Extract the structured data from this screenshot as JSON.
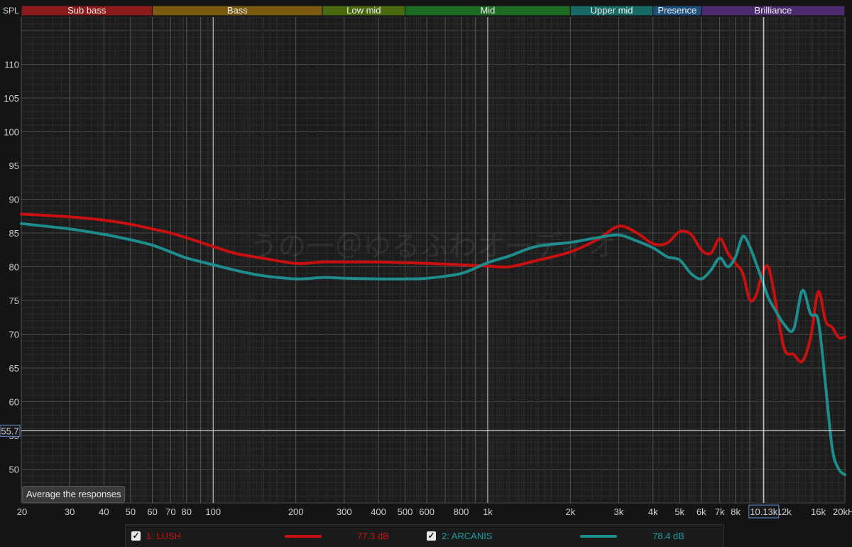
{
  "chart_data": {
    "type": "line",
    "ylabel": "SPL",
    "xscale": "log",
    "xlim": [
      20,
      20000
    ],
    "ylim": [
      45,
      117
    ],
    "grid": true,
    "yticks": [
      50,
      55,
      60,
      65,
      70,
      75,
      80,
      85,
      90,
      95,
      100,
      105,
      110
    ],
    "xticks": [
      {
        "v": 20,
        "t": "20"
      },
      {
        "v": 30,
        "t": "30"
      },
      {
        "v": 40,
        "t": "40"
      },
      {
        "v": 50,
        "t": "50"
      },
      {
        "v": 60,
        "t": "60"
      },
      {
        "v": 70,
        "t": "70"
      },
      {
        "v": 80,
        "t": "80"
      },
      {
        "v": 100,
        "t": "100"
      },
      {
        "v": 200,
        "t": "200"
      },
      {
        "v": 300,
        "t": "300"
      },
      {
        "v": 400,
        "t": "400"
      },
      {
        "v": 500,
        "t": "500"
      },
      {
        "v": 600,
        "t": "600"
      },
      {
        "v": 800,
        "t": "800"
      },
      {
        "v": 1000,
        "t": "1k"
      },
      {
        "v": 2000,
        "t": "2k"
      },
      {
        "v": 3000,
        "t": "3k"
      },
      {
        "v": 4000,
        "t": "4k"
      },
      {
        "v": 5000,
        "t": "5k"
      },
      {
        "v": 6000,
        "t": "6k"
      },
      {
        "v": 7000,
        "t": "7k"
      },
      {
        "v": 8000,
        "t": "8k"
      },
      {
        "v": 12000,
        "t": "12k"
      },
      {
        "v": 16000,
        "t": "16k"
      },
      {
        "v": 20000,
        "t": "20kHz"
      }
    ],
    "bands": [
      {
        "label": "Sub bass",
        "from": 20,
        "to": 60,
        "color": "#8b1a1a"
      },
      {
        "label": "Bass",
        "from": 60,
        "to": 250,
        "color": "#7a5a10"
      },
      {
        "label": "Low mid",
        "from": 250,
        "to": 500,
        "color": "#4a6a10"
      },
      {
        "label": "Mid",
        "from": 500,
        "to": 2000,
        "color": "#1c6b22"
      },
      {
        "label": "Upper mid",
        "from": 2000,
        "to": 4000,
        "color": "#186a66"
      },
      {
        "label": "Presence",
        "from": 4000,
        "to": 6000,
        "color": "#1d4f7a"
      },
      {
        "label": "Brilliance",
        "from": 6000,
        "to": 20000,
        "color": "#4b2a6e"
      }
    ],
    "cursor": {
      "x": 10130,
      "x_label": "10.13k",
      "y": 55.7,
      "y_label": "55.7"
    },
    "series": [
      {
        "name": "1: LUSH",
        "color": "#c81010",
        "x": [
          20,
          30,
          40,
          50,
          60,
          70,
          80,
          100,
          120,
          150,
          200,
          250,
          300,
          400,
          500,
          600,
          800,
          1000,
          1200,
          1500,
          2000,
          2500,
          3000,
          3500,
          4000,
          4500,
          5000,
          5500,
          6000,
          6500,
          7000,
          7500,
          8000,
          8500,
          9000,
          9500,
          10000,
          10500,
          11000,
          12000,
          13000,
          14000,
          15000,
          16000,
          17000,
          18000,
          19000,
          20000
        ],
        "values": [
          87.8,
          87.4,
          86.9,
          86.3,
          85.6,
          85.0,
          84.3,
          83.0,
          82.0,
          81.3,
          80.5,
          80.7,
          80.7,
          80.7,
          80.6,
          80.5,
          80.3,
          80.1,
          80.0,
          80.9,
          82.2,
          84.0,
          86.0,
          85.0,
          83.4,
          83.5,
          85.2,
          84.8,
          82.5,
          82.0,
          84.2,
          82.0,
          80.5,
          79.0,
          75.1,
          75.8,
          79.0,
          80.0,
          76.5,
          68.0,
          67.0,
          66.0,
          69.5,
          76.3,
          72.0,
          71.0,
          69.5,
          69.6
        ]
      },
      {
        "name": "2: ARCANIS",
        "color": "#1e8c8c",
        "x": [
          20,
          30,
          40,
          50,
          60,
          70,
          80,
          100,
          120,
          150,
          200,
          250,
          300,
          400,
          500,
          600,
          800,
          1000,
          1200,
          1500,
          2000,
          2500,
          3000,
          3500,
          4000,
          4500,
          5000,
          5500,
          6000,
          6500,
          7000,
          7500,
          8000,
          8500,
          9000,
          9500,
          10000,
          10500,
          11000,
          12000,
          13000,
          14000,
          15000,
          16000,
          17000,
          18000,
          19000,
          20000
        ],
        "values": [
          86.4,
          85.6,
          84.8,
          84.0,
          83.2,
          82.2,
          81.3,
          80.3,
          79.5,
          78.7,
          78.2,
          78.4,
          78.3,
          78.2,
          78.2,
          78.3,
          79.0,
          80.6,
          81.6,
          83.0,
          83.6,
          84.3,
          84.7,
          83.8,
          82.8,
          81.5,
          81.0,
          79.0,
          78.2,
          79.5,
          81.3,
          80.0,
          81.5,
          84.5,
          83.0,
          80.5,
          78.0,
          75.5,
          74.0,
          71.5,
          70.7,
          76.5,
          73.0,
          72.0,
          62.5,
          53.0,
          50.0,
          49.2
        ]
      }
    ]
  },
  "ui": {
    "average_button": "Average the responses",
    "watermark": "うの一＠ゆるふわオーディオ"
  },
  "legend": [
    {
      "checked": true,
      "check_glyph": "✓",
      "name": "1: LUSH",
      "db": "77.3 dB",
      "color": "#c81010"
    },
    {
      "checked": true,
      "check_glyph": "✓",
      "name": "2: ARCANIS",
      "db": "78.4 dB",
      "color": "#1e8c8c"
    }
  ]
}
